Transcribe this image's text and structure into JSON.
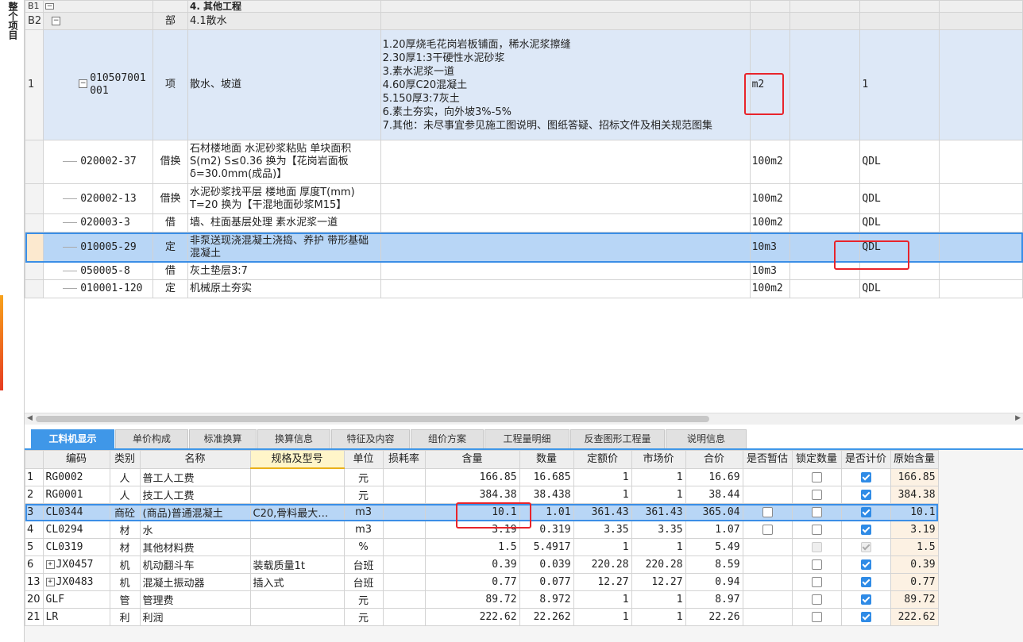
{
  "sidebar": {
    "label": "整个项目"
  },
  "top_table": {
    "title_row": {
      "code": "B1",
      "name": "4. 其他工程"
    },
    "sub_row": {
      "code": "B2",
      "type": "部",
      "name": "4.1散水"
    },
    "item_row": {
      "num": "1",
      "code": "010507001001",
      "type": "项",
      "name": "散水、坡道",
      "features": [
        "1.20厚烧毛花岗岩板铺面，稀水泥浆擦缝",
        "2.30厚1:3干硬性水泥砂浆",
        "3.素水泥浆一道",
        "4.60厚C20混凝土",
        "5.150厚3:7灰土",
        "6.素土夯实，向外坡3%-5%",
        "7.其他：未尽事宜参见施工图说明、图纸答疑、招标文件及相关规范图集"
      ],
      "unit": "m2",
      "qty": "1"
    },
    "sub_items": [
      {
        "code": "020002-37",
        "type": "借换",
        "name": "石材楼地面 水泥砂浆粘贴 单块面积S(m2) S≤0.36  换为【花岗岩面板δ=30.0mm(成品)】",
        "unit": "100m2",
        "qty": "QDL"
      },
      {
        "code": "020002-13",
        "type": "借换",
        "name": "水泥砂浆找平层 楼地面 厚度T(mm) T=20  换为【干混地面砂浆M15】",
        "unit": "100m2",
        "qty": "QDL"
      },
      {
        "code": "020003-3",
        "type": "借",
        "name": "墙、柱面基层处理 素水泥浆一道",
        "unit": "100m2",
        "qty": "QDL"
      },
      {
        "code": "010005-29",
        "type": "定",
        "name": "非泵送现浇混凝土浇捣、养护 带形基础 混凝土",
        "unit": "10m3",
        "qty": "QDL"
      },
      {
        "code": "050005-8",
        "type": "借",
        "name": "灰土垫层3:7",
        "unit": "10m3",
        "qty": ""
      },
      {
        "code": "010001-120",
        "type": "定",
        "name": "机械原土夯实",
        "unit": "100m2",
        "qty": "QDL"
      }
    ]
  },
  "tabs": [
    "工料机显示",
    "单价构成",
    "标准换算",
    "换算信息",
    "特征及内容",
    "组价方案",
    "工程量明细",
    "反查图形工程量",
    "说明信息"
  ],
  "bottom_table": {
    "headers": [
      "编码",
      "类别",
      "名称",
      "规格及型号",
      "单位",
      "损耗率",
      "含量",
      "数量",
      "定额价",
      "市场价",
      "合价",
      "是否暂估",
      "锁定数量",
      "是否计价",
      "原始含量"
    ],
    "rows": [
      {
        "num": "1",
        "code": "RG0002",
        "cat": "人",
        "name": "普工人工费",
        "spec": "",
        "unit": "元",
        "loss": "",
        "content": "166.85",
        "qty": "16.685",
        "base": "1",
        "market": "1",
        "total": "16.69",
        "est": null,
        "lock": false,
        "priced": true,
        "orig": "166.85"
      },
      {
        "num": "2",
        "code": "RG0001",
        "cat": "人",
        "name": "技工人工费",
        "spec": "",
        "unit": "元",
        "loss": "",
        "content": "384.38",
        "qty": "38.438",
        "base": "1",
        "market": "1",
        "total": "38.44",
        "est": null,
        "lock": false,
        "priced": true,
        "orig": "384.38"
      },
      {
        "num": "3",
        "code": "CL0344",
        "cat": "商砼",
        "name": "(商品)普通混凝土",
        "spec": "C20,骨料最大…",
        "unit": "m3",
        "loss": "",
        "content": "10.1",
        "qty": "1.01",
        "base": "361.43",
        "market": "361.43",
        "total": "365.04",
        "est": false,
        "lock": false,
        "priced": true,
        "orig": "10.1"
      },
      {
        "num": "4",
        "code": "CL0294",
        "cat": "材",
        "name": "水",
        "spec": "",
        "unit": "m3",
        "loss": "",
        "content": "3.19",
        "qty": "0.319",
        "base": "3.35",
        "market": "3.35",
        "total": "1.07",
        "est": false,
        "lock": false,
        "priced": true,
        "orig": "3.19"
      },
      {
        "num": "5",
        "code": "CL0319",
        "cat": "材",
        "name": "其他材料费",
        "spec": "",
        "unit": "%",
        "loss": "",
        "content": "1.5",
        "qty": "5.4917",
        "base": "1",
        "market": "1",
        "total": "5.49",
        "est": null,
        "lock": "disabled",
        "priced": "disabled",
        "orig": "1.5"
      },
      {
        "num": "6",
        "code": "JX0457",
        "cat": "机",
        "name": "机动翻斗车",
        "spec": "装载质量1t",
        "unit": "台班",
        "loss": "",
        "content": "0.39",
        "qty": "0.039",
        "base": "220.28",
        "market": "220.28",
        "total": "8.59",
        "est": null,
        "lock": false,
        "priced": true,
        "orig": "0.39",
        "expand": true
      },
      {
        "num": "13",
        "code": "JX0483",
        "cat": "机",
        "name": "混凝土振动器",
        "spec": "插入式",
        "unit": "台班",
        "loss": "",
        "content": "0.77",
        "qty": "0.077",
        "base": "12.27",
        "market": "12.27",
        "total": "0.94",
        "est": null,
        "lock": false,
        "priced": true,
        "orig": "0.77",
        "expand": true
      },
      {
        "num": "20",
        "code": "GLF",
        "cat": "管",
        "name": "管理费",
        "spec": "",
        "unit": "元",
        "loss": "",
        "content": "89.72",
        "qty": "8.972",
        "base": "1",
        "market": "1",
        "total": "8.97",
        "est": null,
        "lock": false,
        "priced": true,
        "orig": "89.72"
      },
      {
        "num": "21",
        "code": "LR",
        "cat": "利",
        "name": "利润",
        "spec": "",
        "unit": "元",
        "loss": "",
        "content": "222.62",
        "qty": "22.262",
        "base": "1",
        "market": "1",
        "total": "22.26",
        "est": null,
        "lock": false,
        "priced": true,
        "orig": "222.62"
      }
    ]
  },
  "colors": {
    "accent": "#3f97e8",
    "selection": "#b8d6f6",
    "highlight_box": "#e8242b"
  }
}
